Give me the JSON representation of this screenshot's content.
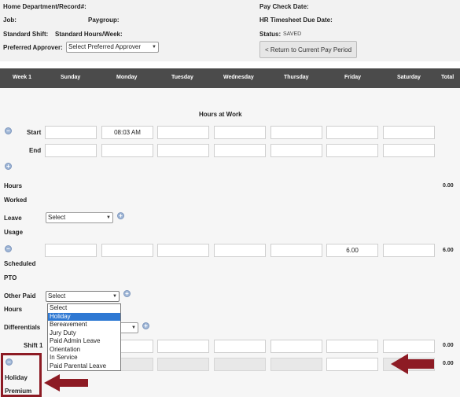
{
  "header": {
    "home_dept_label": "Home Department/Record#:",
    "home_dept_value": "",
    "job_label": "Job:",
    "job_value": "",
    "paygroup_label": "Paygroup:",
    "paygroup_value": "",
    "standard_shift_label": "Standard Shift:",
    "standard_hours_label": "Standard Hours/Week:",
    "preferred_approver_label": "Preferred Approver:",
    "preferred_approver_value": "Select Preferred Approver",
    "pay_check_date_label": "Pay Check Date:",
    "hr_due_label": "HR Timesheet Due Date:",
    "status_label": "Status:",
    "status_value": "SAVED",
    "return_button": "< Return to Current Pay Period"
  },
  "week_bar": {
    "week": "Week 1",
    "days": [
      "Sunday",
      "Monday",
      "Tuesday",
      "Wednesday",
      "Thursday",
      "Friday",
      "Saturday"
    ],
    "total": "Total"
  },
  "section_title": "Hours at Work",
  "rows": {
    "start_label": "Start",
    "end_label": "End",
    "start_values": [
      "",
      "08:03 AM",
      "",
      "",
      "",
      "",
      ""
    ],
    "end_values": [
      "",
      "",
      "",
      "",
      "",
      "",
      ""
    ],
    "hours_worked_label_1": "Hours",
    "hours_worked_label_2": "Worked",
    "hours_worked_total": "0.00",
    "leave_label_1": "Leave",
    "leave_label_2": "Usage",
    "leave_select": "Select",
    "leave_values": [
      "",
      "",
      "",
      "",
      "",
      "6.00",
      ""
    ],
    "leave_total": "6.00",
    "scheduled_label_1": "Scheduled",
    "scheduled_label_2": "PTO",
    "other_paid_label_1": "Other Paid",
    "other_paid_label_2": "Hours",
    "other_paid_select": "Select",
    "differentials_label": "Differentials",
    "shift1_label": "Shift 1",
    "shift1_total": "0.00",
    "holiday_label_1": "Holiday",
    "holiday_label_2": "Premium",
    "holiday_total": "0.00"
  },
  "dropdown_options": [
    "Select",
    "Holiday",
    "Bereavement",
    "Jury Duty",
    "Paid Admin Leave",
    "Orientation",
    "In Service",
    "Paid Parental Leave"
  ],
  "dropdown_selected_index": 1,
  "colors": {
    "header_bg": "#f2f2f2",
    "bar_bg": "#4b4b4b",
    "grid_bg": "#f6f6f6",
    "highlight": "#2e78d3",
    "annotation": "#8d1b24"
  }
}
